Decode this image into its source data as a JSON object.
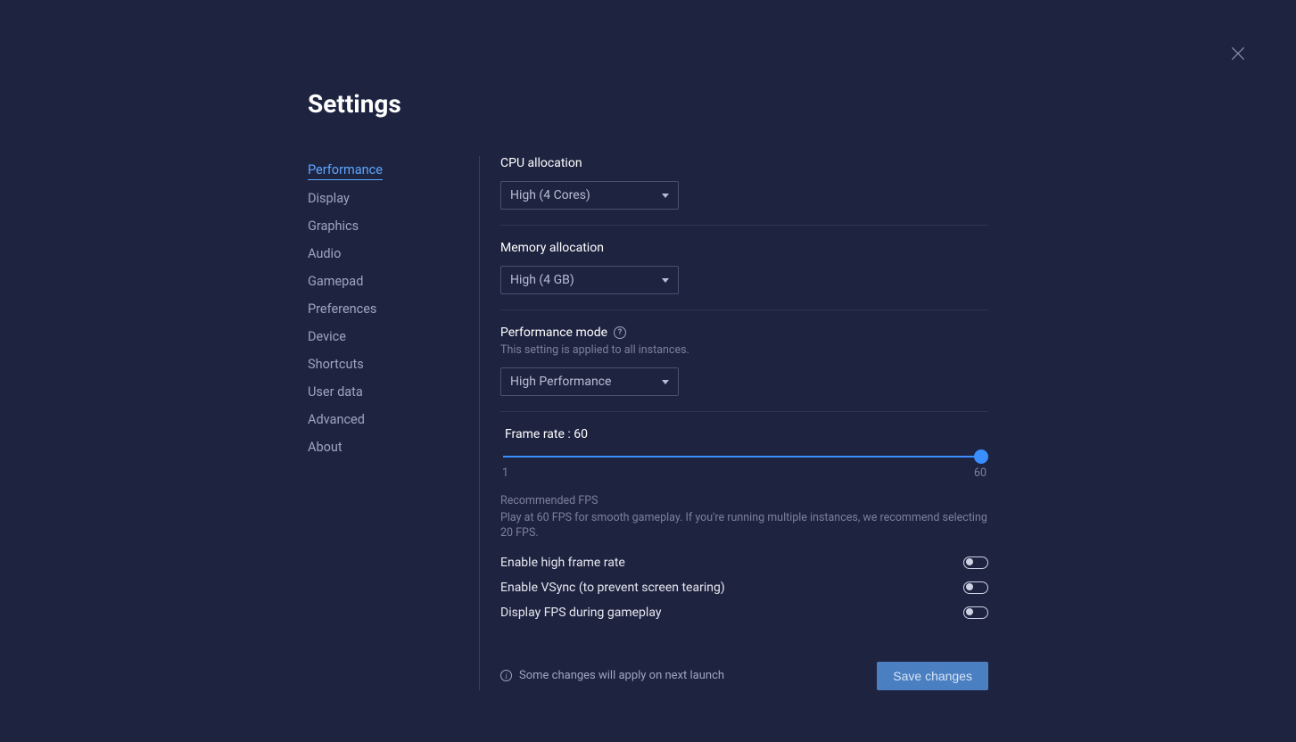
{
  "title": "Settings",
  "sidebar": {
    "items": [
      {
        "label": "Performance",
        "active": true
      },
      {
        "label": "Display",
        "active": false
      },
      {
        "label": "Graphics",
        "active": false
      },
      {
        "label": "Audio",
        "active": false
      },
      {
        "label": "Gamepad",
        "active": false
      },
      {
        "label": "Preferences",
        "active": false
      },
      {
        "label": "Device",
        "active": false
      },
      {
        "label": "Shortcuts",
        "active": false
      },
      {
        "label": "User data",
        "active": false
      },
      {
        "label": "Advanced",
        "active": false
      },
      {
        "label": "About",
        "active": false
      }
    ]
  },
  "cpu_allocation": {
    "label": "CPU allocation",
    "value": "High (4 Cores)"
  },
  "memory_allocation": {
    "label": "Memory allocation",
    "value": "High (4 GB)"
  },
  "performance_mode": {
    "label": "Performance mode",
    "sublabel": "This setting is applied to all instances.",
    "value": "High Performance"
  },
  "frame_rate": {
    "label_prefix": "Frame rate : ",
    "value": "60",
    "min": "1",
    "max": "60",
    "hint_title": "Recommended FPS",
    "hint_text": "Play at 60 FPS for smooth gameplay. If you're running multiple instances, we recommend selecting 20 FPS."
  },
  "toggles": {
    "high_frame_rate": {
      "label": "Enable high frame rate",
      "on": false
    },
    "vsync": {
      "label": "Enable VSync (to prevent screen tearing)",
      "on": false
    },
    "display_fps": {
      "label": "Display FPS during gameplay",
      "on": false
    }
  },
  "footer": {
    "note": "Some changes will apply on next launch",
    "save_label": "Save changes"
  }
}
